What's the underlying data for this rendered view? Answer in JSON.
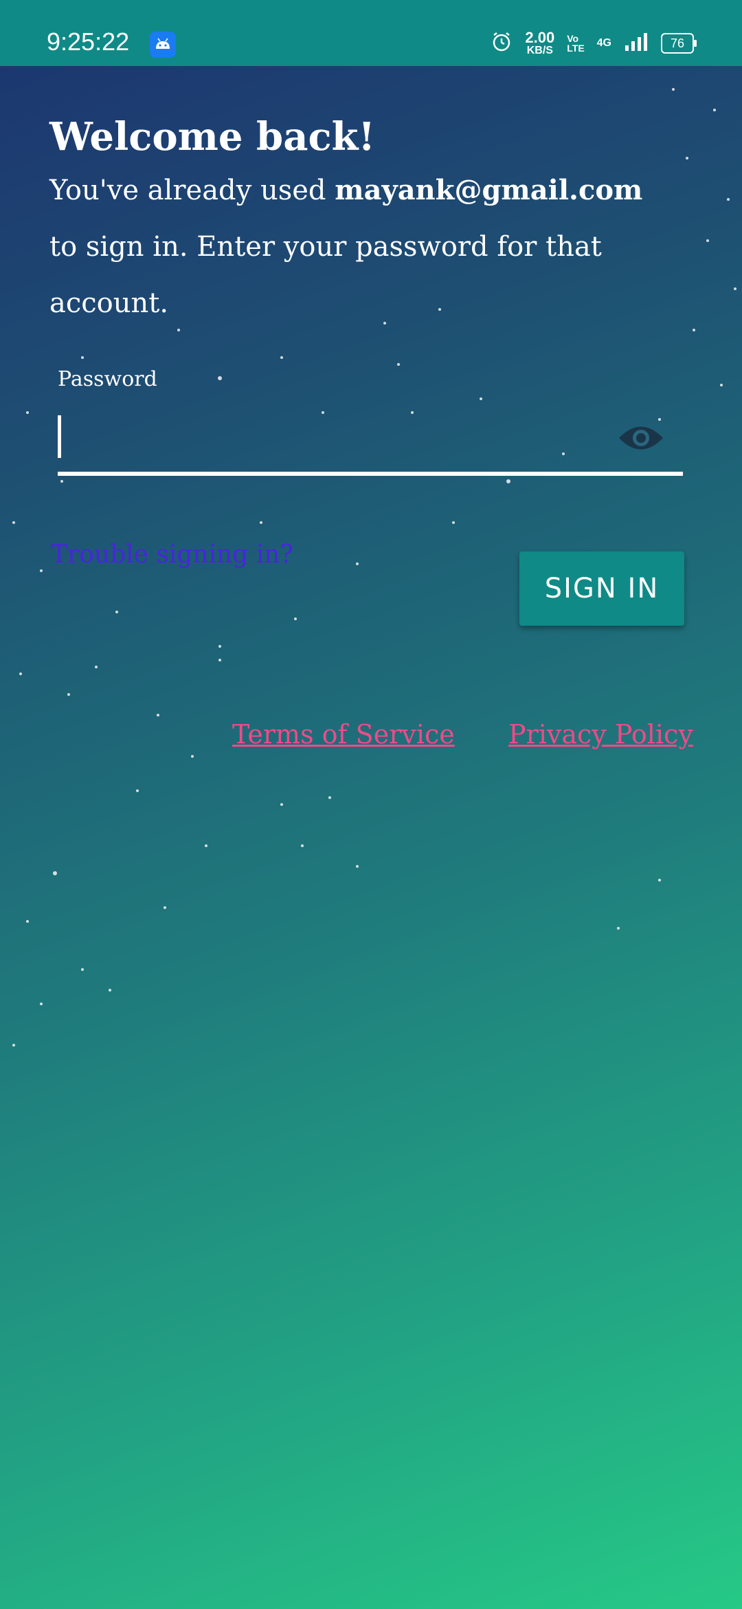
{
  "status_bar": {
    "time": "9:25:22",
    "speed_value": "2.00",
    "speed_unit": "KB/S",
    "volte_top": "Vo",
    "volte_bottom": "LTE",
    "network": "4G",
    "battery": "76"
  },
  "screen": {
    "title": "Welcome back!",
    "description_prefix": "You've already used",
    "email": "mayank@gmail.com",
    "description_suffix": "to sign in. Enter your password for that account.",
    "password_label": "Password",
    "password_value": "",
    "trouble_link": "Trouble signing in?",
    "sign_in_button": "SIGN IN",
    "terms_link": "Terms of Service",
    "privacy_link": "Privacy Policy"
  },
  "colors": {
    "accent": "#0f8a87",
    "link_pink": "#ef4b87",
    "link_purple": "#4a23e0"
  },
  "icons": [
    "android-icon",
    "alarm-icon",
    "signal-icon",
    "battery-icon",
    "eye-icon"
  ]
}
